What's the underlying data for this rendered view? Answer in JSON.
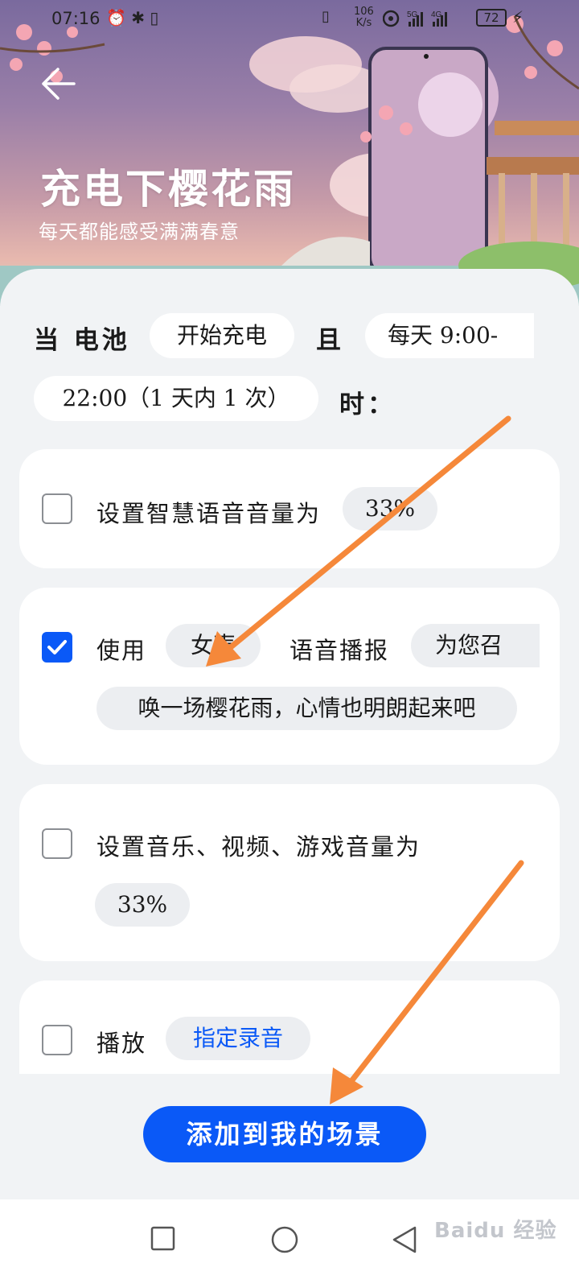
{
  "status_bar": {
    "time": "07:16",
    "left_icons": "⏰ ✱ ▯",
    "net_speed_value": "106",
    "net_speed_unit": "K/s",
    "signal_text": "5G 4G",
    "battery": "72"
  },
  "hero": {
    "title": "充电下樱花雨",
    "subtitle": "每天都能感受满满春意"
  },
  "condition": {
    "when_label": "当 电池",
    "trigger_value": "开始充电",
    "and_label": "且",
    "time_value_part1": "每天 9:00-",
    "time_value_part2": "22:00（1 天内 1 次）",
    "suffix_label": "时："
  },
  "actions": [
    {
      "checked": false,
      "label": "设置智慧语音音量为",
      "value": "33%"
    },
    {
      "checked": true,
      "label_use": "使用",
      "voice_value": "女声",
      "label_broadcast": "语音播报",
      "message_part1": "为您召",
      "message_part2": "唤一场樱花雨，心情也明朗起来吧"
    },
    {
      "checked": false,
      "label": "设置音乐、视频、游戏音量为",
      "value": "33%"
    },
    {
      "checked": false,
      "label": "播放",
      "value": "指定录音"
    }
  ],
  "add_button_label": "添加到我的场景",
  "navbar": {
    "recents": "recents-square-icon",
    "home": "home-circle-icon",
    "back": "back-triangle-icon"
  },
  "watermark": "Baidu 经验",
  "colors": {
    "accent": "#0a59f7",
    "annotation_arrow": "#f5883a",
    "background": "#f1f3f5"
  }
}
